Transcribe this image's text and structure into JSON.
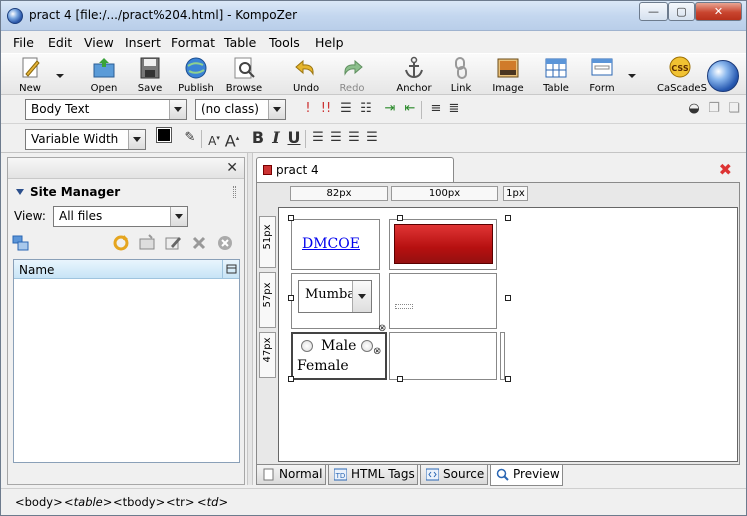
{
  "window": {
    "title": "pract 4 [file:/.../pract%204.html] - KompoZer",
    "minimize_label": "—",
    "maximize_label": "▢",
    "close_label": "✕"
  },
  "menu": [
    "File",
    "Edit",
    "View",
    "Insert",
    "Format",
    "Table",
    "Tools",
    "Help"
  ],
  "toolbar": {
    "new": "New",
    "open": "Open",
    "save": "Save",
    "publish": "Publish",
    "browse": "Browse",
    "undo": "Undo",
    "redo": "Redo",
    "anchor": "Anchor",
    "link": "Link",
    "image": "Image",
    "table": "Table",
    "form": "Form",
    "cascades": "CaScadeS"
  },
  "format1": {
    "paragraph_style": "Body Text",
    "class": "(no class)"
  },
  "format2": {
    "font": "Variable Width",
    "bold": "B",
    "italic": "I",
    "underline": "U"
  },
  "sidebar": {
    "close": "✕",
    "title": "Site Manager",
    "view_label": "View:",
    "view_value": "All files",
    "column_name": "Name"
  },
  "editor": {
    "tab_title": "pract 4",
    "rulers": {
      "col1": "82px",
      "col2": "100px",
      "col3": "1px",
      "row1": "51px",
      "row2": "57px",
      "row3": "47px"
    },
    "content": {
      "link_text": "DMCOE",
      "select_value": "Mumbai",
      "radio_male": "Male",
      "radio_female": "Female"
    },
    "view_tabs": [
      "Normal",
      "HTML Tags",
      "Source",
      "Preview"
    ],
    "active_view_tab": "Preview"
  },
  "statusbar": {
    "tags": [
      "<body>",
      "<table>",
      "<tbody>",
      "<tr>",
      "<td>"
    ]
  },
  "colors": {
    "accent": "#c4d7ef",
    "link": "#0000ee",
    "button_red": "#b61010"
  }
}
